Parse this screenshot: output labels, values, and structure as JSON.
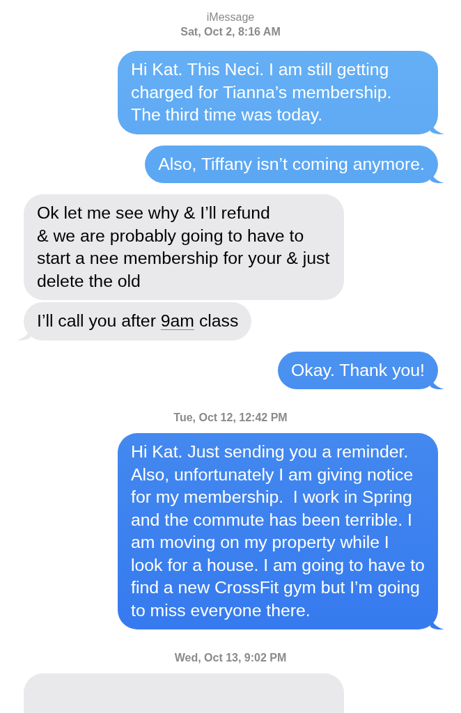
{
  "header": {
    "service": "iMessage",
    "timestamp": "Sat, Oct 2, 8:16 AM"
  },
  "thread": [
    {
      "kind": "sent",
      "tail": true,
      "segments": [
        {
          "text": "Hi Kat. This Neci. I am still getting charged for Tianna’s membership. The third time was today."
        }
      ]
    },
    {
      "kind": "sent",
      "tail": true,
      "segments": [
        {
          "text": "Also, Tiffany isn’t coming anymore."
        }
      ]
    },
    {
      "kind": "received",
      "tail": false,
      "segments": [
        {
          "text": "Ok let me see why & I’ll refund\n& we are probably going to have to start a nee membership for your & just delete the old"
        }
      ]
    },
    {
      "kind": "received",
      "tail": true,
      "segments": [
        {
          "text": "I’ll call you after "
        },
        {
          "text": "9am",
          "link": true
        },
        {
          "text": " class"
        }
      ]
    },
    {
      "kind": "sent",
      "tail": true,
      "segments": [
        {
          "text": "Okay. Thank you!"
        }
      ]
    },
    {
      "kind": "timestamp",
      "text": "Tue, Oct 12, 12:42 PM"
    },
    {
      "kind": "sent",
      "tail": true,
      "segments": [
        {
          "text": "Hi Kat. Just sending you a reminder. Also, unfortunately I am giving notice for my membership.  I work in Spring and the commute has been terrible. I am moving on my property while I look for a house. I am going to have to find a new CrossFit gym but I’m going to miss everyone there."
        }
      ]
    },
    {
      "kind": "timestamp",
      "text": "Wed, Oct 13, 9:02 PM"
    },
    {
      "kind": "received"
    }
  ]
}
